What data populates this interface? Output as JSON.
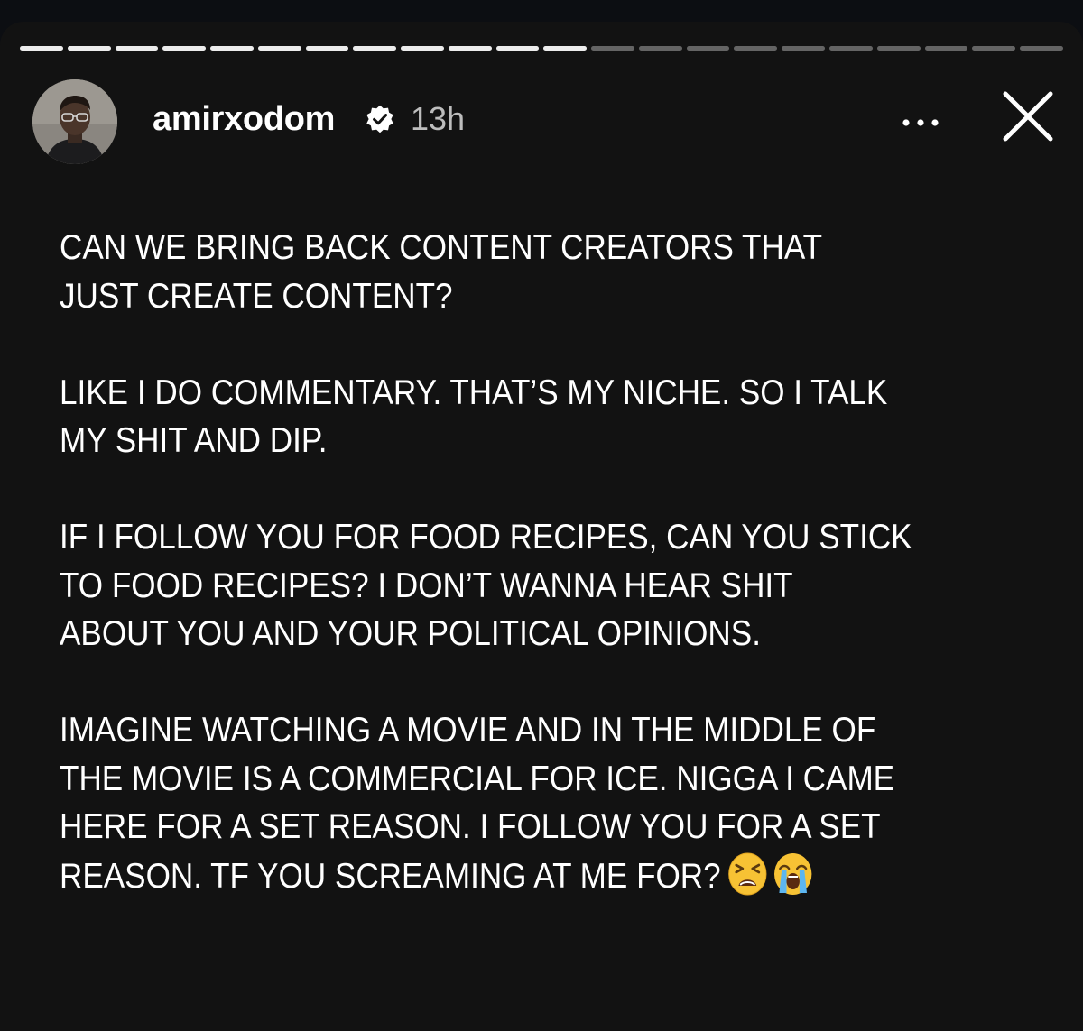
{
  "story": {
    "progress": {
      "segments": 22,
      "completed": 12
    },
    "header": {
      "username": "amirxodom",
      "verified": true,
      "timestamp": "13h",
      "avatar_icon": "avatar",
      "verified_icon": "verified-badge-icon",
      "more_icon": "more-options-icon",
      "close_icon": "close-icon"
    },
    "paragraphs": [
      "CAN WE BRING BACK CONTENT CREATORS THAT\nJUST CREATE CONTENT?",
      "LIKE I DO COMMENTARY. THAT’S MY NICHE. SO I TALK\nMY SHIT AND DIP.",
      "IF I FOLLOW YOU FOR FOOD RECIPES, CAN YOU STICK\nTO FOOD RECIPES? I DON’T WANNA HEAR SHIT\nABOUT YOU AND YOUR POLITICAL OPINIONS.",
      "IMAGINE WATCHING A MOVIE AND IN THE MIDDLE OF\nTHE MOVIE IS A COMMERCIAL FOR ICE. NIGGA I CAME\nHERE FOR A SET REASON. I FOLLOW YOU FOR A SET\nREASON. TF YOU SCREAMING AT ME FOR?"
    ],
    "emojis": [
      "tired-face-emoji",
      "loudly-crying-face-emoji"
    ]
  },
  "colors": {
    "background": "#121212",
    "text": "#ffffff",
    "progress_done": "#ffffff",
    "progress_pending": "#5c5c5c"
  }
}
